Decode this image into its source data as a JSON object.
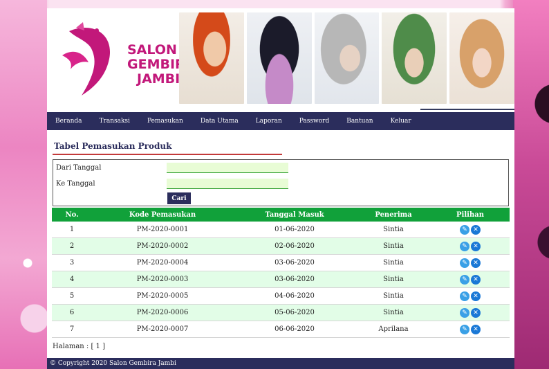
{
  "brand": {
    "line1": "SALON",
    "line2": "GEMBIRA",
    "line3": "JAMBI",
    "color": "#c2187a"
  },
  "nav": {
    "items": [
      "Beranda",
      "Transaksi",
      "Pemasukan",
      "Data Utama",
      "Laporan",
      "Password",
      "Bantuan",
      "Keluar"
    ]
  },
  "page": {
    "title": "Tabel Pemasukan Produk"
  },
  "search": {
    "from_label": "Dari Tanggal",
    "to_label": "Ke Tanggal",
    "from_value": "",
    "to_value": "",
    "button_label": "Cari"
  },
  "table": {
    "headers": [
      "No.",
      "Kode Pemasukan",
      "Tanggal Masuk",
      "Penerima",
      "Pilihan"
    ],
    "rows": [
      {
        "no": "1",
        "kode": "PM-2020-0001",
        "tanggal": "01-06-2020",
        "penerima": "Sintia"
      },
      {
        "no": "2",
        "kode": "PM-2020-0002",
        "tanggal": "02-06-2020",
        "penerima": "Sintia"
      },
      {
        "no": "3",
        "kode": "PM-2020-0004",
        "tanggal": "03-06-2020",
        "penerima": "Sintia"
      },
      {
        "no": "4",
        "kode": "PM-2020-0003",
        "tanggal": "03-06-2020",
        "penerima": "Sintia"
      },
      {
        "no": "5",
        "kode": "PM-2020-0005",
        "tanggal": "04-06-2020",
        "penerima": "Sintia"
      },
      {
        "no": "6",
        "kode": "PM-2020-0006",
        "tanggal": "05-06-2020",
        "penerima": "Sintia"
      },
      {
        "no": "7",
        "kode": "PM-2020-0007",
        "tanggal": "06-06-2020",
        "penerima": "Aprilana"
      }
    ],
    "actions": {
      "edit_icon": "edit-icon",
      "delete_icon": "close-icon"
    }
  },
  "pagination": {
    "text": "Halaman : [ 1 ]"
  },
  "footer": {
    "text": "© Copyright 2020 Salon Gembira Jambi"
  },
  "colors": {
    "navbar": "#2b2d5c",
    "table_header": "#11a13a",
    "row_alt": "#e2fde7",
    "accent_rule": "#c33a3a"
  }
}
